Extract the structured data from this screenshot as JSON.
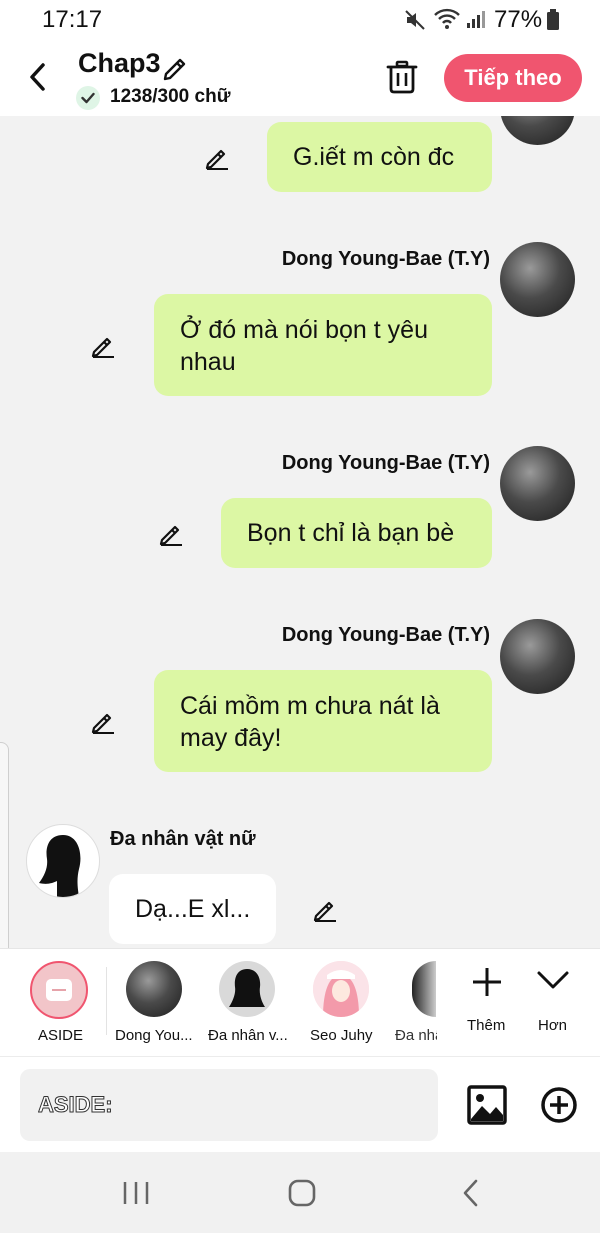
{
  "status_bar": {
    "time": "17:17",
    "battery": "77%"
  },
  "header": {
    "title": "Chap3",
    "word_count": "1238/300 chữ",
    "next_button": "Tiếp theo"
  },
  "messages": [
    {
      "sender": "",
      "text": "G.iết m còn đc"
    },
    {
      "sender": "Dong Young-Bae (T.Y)",
      "text": "Ở đó mà nói bọn t yêu nhau"
    },
    {
      "sender": "Dong Young-Bae (T.Y)",
      "text": "Bọn t chỉ là bạn bè"
    },
    {
      "sender": "Dong Young-Bae (T.Y)",
      "text": "Cái mồm m chưa nát là may đây!"
    },
    {
      "sender": "Đa nhân vật nữ",
      "text": "Dạ...E xl..."
    }
  ],
  "characters": [
    {
      "label": "ASIDE"
    },
    {
      "label": "Dong You..."
    },
    {
      "label": "Đa nhân v..."
    },
    {
      "label": "Seo Juhy"
    },
    {
      "label": "Đa nhâ"
    }
  ],
  "actions": {
    "more_label": "Thêm",
    "less_label": "Hơn"
  },
  "input": {
    "placeholder": "ASIDE:"
  },
  "colors": {
    "accent": "#f0556f",
    "bubble": "#dcf7a4"
  }
}
